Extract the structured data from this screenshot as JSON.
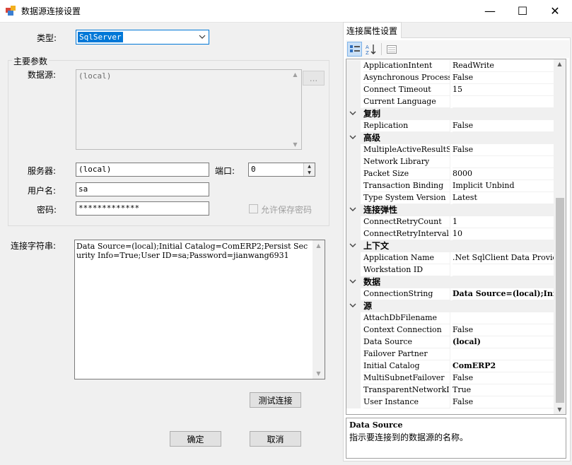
{
  "window": {
    "title": "数据源连接设置",
    "minimize": "—",
    "maximize": "☐",
    "close": "✕"
  },
  "form": {
    "type_label": "类型:",
    "type_value": "SqlServer",
    "group_title": "主要参数",
    "datasource_label": "数据源:",
    "datasource_value": "(local)",
    "browse_button": "...",
    "server_label": "服务器:",
    "server_value": "(local)",
    "port_label": "端口:",
    "port_value": "0",
    "user_label": "用户名:",
    "user_value": "sa",
    "password_label": "密码:",
    "password_value": "*************",
    "save_password_label": "允许保存密码",
    "connstr_label": "连接字符串:",
    "connstr_value": "Data Source=(local);Initial Catalog=ComERP2;Persist Security Info=True;User ID=sa;Password=jianwang6931",
    "test_button": "测试连接",
    "ok_button": "确定",
    "cancel_button": "取消"
  },
  "propgrid": {
    "tab_label": "连接属性设置",
    "toolbar": {
      "categorized_icon": "categorized-icon",
      "alphabetical_icon": "alphabetical-icon",
      "property_pages_icon": "property-pages-icon"
    },
    "rows": [
      {
        "kind": "prop",
        "name": "ApplicationIntent",
        "value": "ReadWrite",
        "bold": false
      },
      {
        "kind": "prop",
        "name": "Asynchronous Processing",
        "value": "False",
        "bold": false
      },
      {
        "kind": "prop",
        "name": "Connect Timeout",
        "value": "15",
        "bold": false
      },
      {
        "kind": "prop",
        "name": "Current Language",
        "value": "",
        "bold": false
      },
      {
        "kind": "cat",
        "name": "复制"
      },
      {
        "kind": "prop",
        "name": "Replication",
        "value": "False",
        "bold": false
      },
      {
        "kind": "cat",
        "name": "高级"
      },
      {
        "kind": "prop",
        "name": "MultipleActiveResultSets",
        "value": "False",
        "bold": false
      },
      {
        "kind": "prop",
        "name": "Network Library",
        "value": "",
        "bold": false
      },
      {
        "kind": "prop",
        "name": "Packet Size",
        "value": "8000",
        "bold": false
      },
      {
        "kind": "prop",
        "name": "Transaction Binding",
        "value": "Implicit Unbind",
        "bold": false
      },
      {
        "kind": "prop",
        "name": "Type System Version",
        "value": "Latest",
        "bold": false
      },
      {
        "kind": "cat",
        "name": "连接弹性"
      },
      {
        "kind": "prop",
        "name": "ConnectRetryCount",
        "value": "1",
        "bold": false
      },
      {
        "kind": "prop",
        "name": "ConnectRetryInterval",
        "value": "10",
        "bold": false
      },
      {
        "kind": "cat",
        "name": "上下文"
      },
      {
        "kind": "prop",
        "name": "Application Name",
        "value": ".Net SqlClient Data Provider",
        "bold": false
      },
      {
        "kind": "prop",
        "name": "Workstation ID",
        "value": "",
        "bold": false
      },
      {
        "kind": "cat",
        "name": "数据"
      },
      {
        "kind": "prop",
        "name": "ConnectionString",
        "value": "Data Source=(local);Initial",
        "bold": true
      },
      {
        "kind": "cat",
        "name": "源"
      },
      {
        "kind": "prop",
        "name": "AttachDbFilename",
        "value": "",
        "bold": false
      },
      {
        "kind": "prop",
        "name": "Context Connection",
        "value": "False",
        "bold": false
      },
      {
        "kind": "prop",
        "name": "Data Source",
        "value": "(local)",
        "bold": true
      },
      {
        "kind": "prop",
        "name": "Failover Partner",
        "value": "",
        "bold": false
      },
      {
        "kind": "prop",
        "name": "Initial Catalog",
        "value": "ComERP2",
        "bold": true
      },
      {
        "kind": "prop",
        "name": "MultiSubnetFailover",
        "value": "False",
        "bold": false
      },
      {
        "kind": "prop",
        "name": "TransparentNetworkIPResolution",
        "value": "True",
        "bold": false
      },
      {
        "kind": "prop",
        "name": "User Instance",
        "value": "False",
        "bold": false
      }
    ],
    "desc_title": "Data Source",
    "desc_text": "指示要连接到的数据源的名称。"
  }
}
